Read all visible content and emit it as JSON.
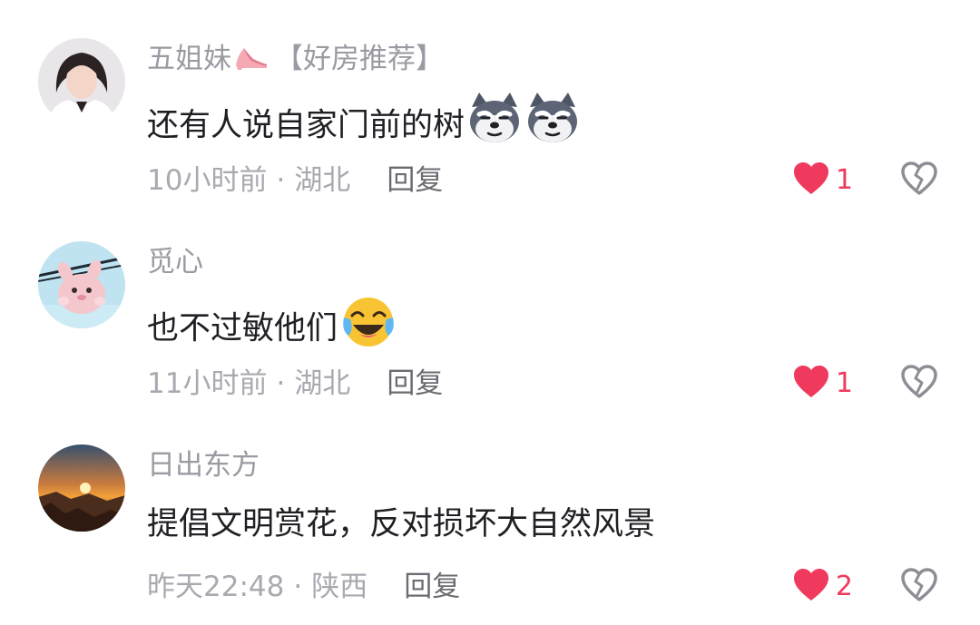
{
  "colors": {
    "username": "#9a9aa2",
    "text": "#1f1f24",
    "meta": "#a9a9b0",
    "reply": "#6b6b72",
    "like": "#ef3a5d",
    "dislike_icon": "#8d8d95"
  },
  "comments": [
    {
      "username": "五姐妹",
      "username_icon": "high-heel-icon",
      "tag": "【好房推荐】",
      "text": "还有人说自家门前的树",
      "emojis": [
        "husky-dog-emoji",
        "husky-dog-emoji"
      ],
      "time": "10小时前",
      "location": "湖北",
      "reply_label": "回复",
      "likes": "1"
    },
    {
      "username": "觅心",
      "tag": "",
      "text": "也不过敏他们",
      "emojis": [
        "crying-laughing-emoji"
      ],
      "time": "11小时前",
      "location": "湖北",
      "reply_label": "回复",
      "likes": "1"
    },
    {
      "username": "日出东方",
      "tag": "",
      "text": "提倡文明赏花，反对损坏大自然风景",
      "emojis": [],
      "time": "昨天22:48",
      "location": "陕西",
      "reply_label": "回复",
      "likes": "2"
    }
  ],
  "separator": "·",
  "icons": {
    "like": "heart-icon",
    "dislike": "broken-heart-icon"
  }
}
